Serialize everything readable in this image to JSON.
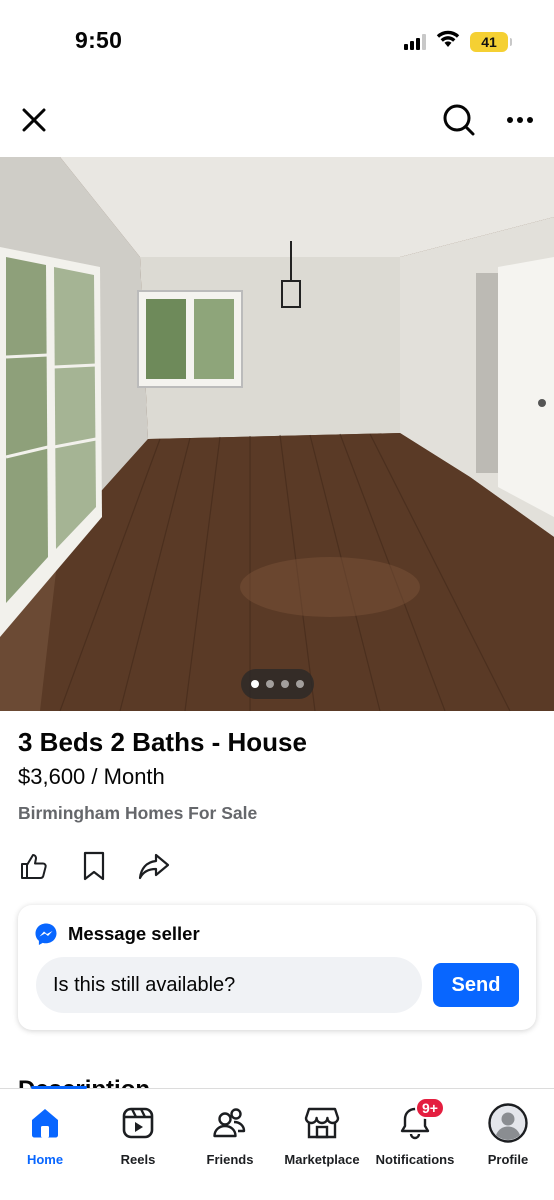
{
  "status_bar": {
    "time": "9:50",
    "battery": "41"
  },
  "listing": {
    "title": "3 Beds 2 Baths - House",
    "price": "$3,600 / Month",
    "seller": "Birmingham Homes For Sale",
    "photo_count": 4,
    "photo_index": 1
  },
  "message": {
    "header": "Message seller",
    "input_value": "Is this still available?",
    "send_label": "Send"
  },
  "description": {
    "heading": "Description"
  },
  "tabs": [
    {
      "label": "Home",
      "icon": "home-icon",
      "active": true
    },
    {
      "label": "Reels",
      "icon": "reels-icon",
      "active": false
    },
    {
      "label": "Friends",
      "icon": "friends-icon",
      "active": false
    },
    {
      "label": "Marketplace",
      "icon": "marketplace-icon",
      "active": false
    },
    {
      "label": "Notifications",
      "icon": "bell-icon",
      "active": false,
      "badge": "9+"
    },
    {
      "label": "Profile",
      "icon": "avatar-icon",
      "active": false
    }
  ],
  "colors": {
    "accent": "#0866ff",
    "badge": "#e41e3f",
    "muted_text": "#65676b"
  }
}
